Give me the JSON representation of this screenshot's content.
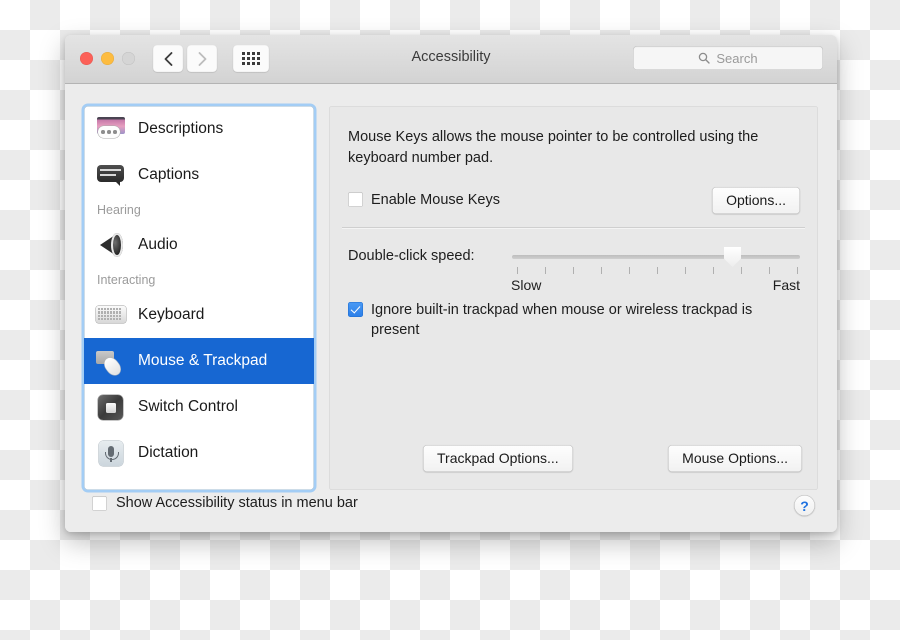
{
  "window": {
    "title": "Accessibility",
    "traffic_lights": [
      "close",
      "minimize",
      "zoom"
    ],
    "nav": {
      "back_icon": "chevron-left-icon",
      "forward_icon": "chevron-right-icon",
      "grid_icon": "show-all-grid-icon"
    },
    "search": {
      "placeholder": "Search",
      "value": "",
      "icon": "search-icon"
    }
  },
  "sidebar": {
    "items": [
      {
        "label": "Descriptions",
        "icon": "descriptions-icon",
        "type": "item",
        "selected": false
      },
      {
        "label": "Captions",
        "icon": "captions-icon",
        "type": "item",
        "selected": false
      },
      {
        "label": "Hearing",
        "type": "header"
      },
      {
        "label": "Audio",
        "icon": "audio-speaker-icon",
        "type": "item",
        "selected": false
      },
      {
        "label": "Interacting",
        "type": "header"
      },
      {
        "label": "Keyboard",
        "icon": "keyboard-icon",
        "type": "item",
        "selected": false
      },
      {
        "label": "Mouse & Trackpad",
        "icon": "mouse-trackpad-icon",
        "type": "item",
        "selected": true
      },
      {
        "label": "Switch Control",
        "icon": "switch-control-icon",
        "type": "item",
        "selected": false
      },
      {
        "label": "Dictation",
        "icon": "dictation-microphone-icon",
        "type": "item",
        "selected": false
      }
    ]
  },
  "pane": {
    "description": "Mouse Keys allows the mouse pointer to be controlled using the keyboard number pad.",
    "enable_mouse_keys": {
      "label": "Enable Mouse Keys",
      "checked": false
    },
    "options_button": "Options...",
    "slider": {
      "label": "Double-click speed:",
      "min_label": "Slow",
      "max_label": "Fast",
      "tick_count": 11,
      "value_position": 9
    },
    "ignore_trackpad": {
      "label": "Ignore built-in trackpad when mouse or wireless trackpad is present",
      "checked": true
    },
    "trackpad_options_button": "Trackpad Options...",
    "mouse_options_button": "Mouse Options..."
  },
  "footer": {
    "show_status": {
      "label": "Show Accessibility status in menu bar",
      "checked": false
    },
    "help_label": "?",
    "help_icon": "help-question-icon"
  }
}
